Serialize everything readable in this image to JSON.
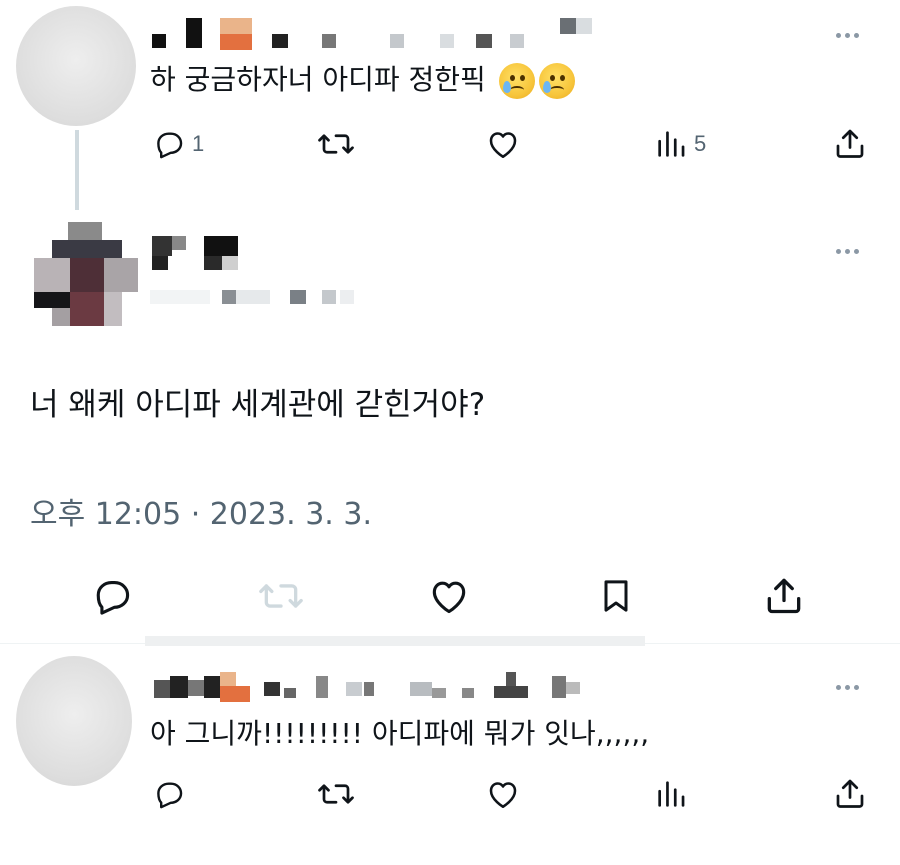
{
  "tweet1": {
    "text": "하 궁금하자너 아디파 정한픽",
    "emoji": [
      "crying-face-emoji",
      "crying-face-emoji"
    ],
    "actions": {
      "reply_count": "1",
      "retweet_count": "",
      "like_count": "",
      "views_count": "5"
    }
  },
  "main_tweet": {
    "text": "너 왜케 아디파 세계관에 갇힌거야?",
    "timestamp": "오후 12:05 · 2023. 3. 3."
  },
  "reply": {
    "text": "아 그니까!!!!!!!!! 아디파에 뭐가 잇나,,,,,,"
  },
  "colors": {
    "text": "#0f1419",
    "secondary": "#536471",
    "disabled": "#cfd9de",
    "divider": "#eff3f4"
  }
}
